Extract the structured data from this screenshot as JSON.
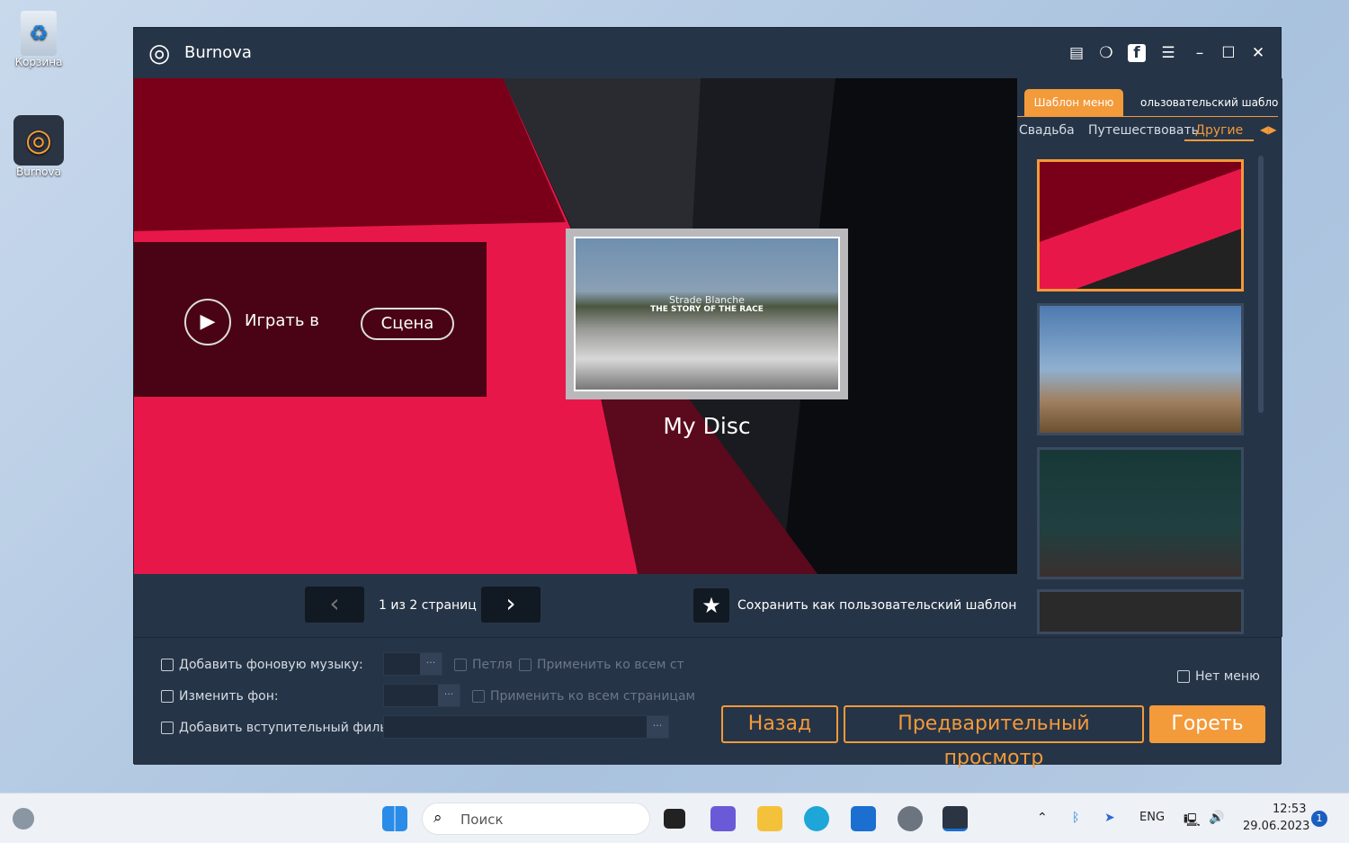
{
  "desktop": {
    "icons": [
      {
        "label": "Корзина",
        "icon": "recycle-bin-icon"
      },
      {
        "label": "Burnova",
        "icon": "burnova-app-icon"
      }
    ]
  },
  "window": {
    "title": "Burnova",
    "toolbar_icons": [
      "document-icon",
      "feedback-icon",
      "facebook-icon",
      "menu-list-icon",
      "minimize-icon",
      "maximize-icon",
      "close-icon"
    ]
  },
  "preview": {
    "play_label": "Играть в",
    "scene_label": "Сцена",
    "disc_title": "My Disc",
    "video_title": "Strade Blanche",
    "video_subtitle": "THE STORY OF THE RACE",
    "colors": {
      "red": "#e8174a",
      "dark_red": "#7a0019"
    }
  },
  "nav": {
    "page_info": "1 из 2 страниц",
    "save_template_label": "Сохранить как пользовательский шаблон"
  },
  "right_panel": {
    "tabs": [
      {
        "label": "Шаблон меню",
        "active": true
      },
      {
        "label": "ользовательский шабло",
        "active": false
      }
    ],
    "categories": [
      {
        "label": "Свадьба"
      },
      {
        "label": "Путешествовать"
      },
      {
        "label": "Другие",
        "active": true
      }
    ],
    "templates": [
      "template-red",
      "template-desert",
      "template-road",
      "template-dark"
    ]
  },
  "bottom": {
    "bg_music_label": "Добавить фоновую музыку:",
    "loop_label": "Петля",
    "apply_all_short": "Применить ко всем ст",
    "change_bg_label": "Изменить фон:",
    "apply_all_pages": "Применить ко всем страницам",
    "intro_label": "Добавить вступительный фильм:",
    "no_menu_label": "Нет меню",
    "dots": "···",
    "back_button": "Назад",
    "preview_button": "Предварительный просмотр",
    "burn_button": "Гореть"
  },
  "taskbar": {
    "search_placeholder": "Поиск",
    "lang": "ENG",
    "time": "12:53",
    "date": "29.06.2023",
    "notification_count": "1"
  },
  "accent": "#f39a3a"
}
